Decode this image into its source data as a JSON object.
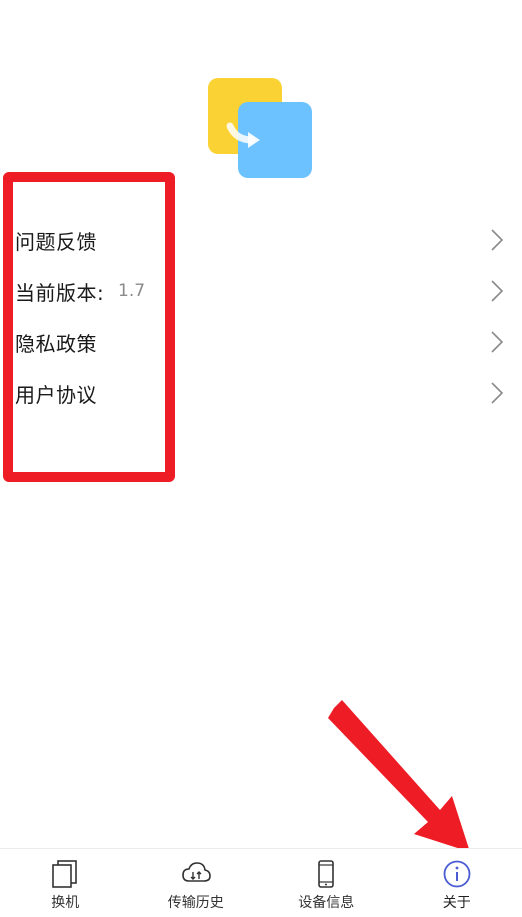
{
  "colors": {
    "accent": "#4a5bd4",
    "highlight": "#ee1c25",
    "logo_yellow": "#fbd233",
    "logo_blue": "#6cc2ff"
  },
  "menu": {
    "items": [
      {
        "label": "问题反馈",
        "value": ""
      },
      {
        "label": "当前版本:",
        "value": "1.7"
      },
      {
        "label": "隐私政策",
        "value": ""
      },
      {
        "label": "用户协议",
        "value": ""
      }
    ]
  },
  "tabbar": {
    "tabs": [
      {
        "label": "换机",
        "icon": "copy-icon"
      },
      {
        "label": "传输历史",
        "icon": "cloud-transfer-icon"
      },
      {
        "label": "设备信息",
        "icon": "phone-icon"
      },
      {
        "label": "关于",
        "icon": "info-icon",
        "active": true
      }
    ]
  }
}
